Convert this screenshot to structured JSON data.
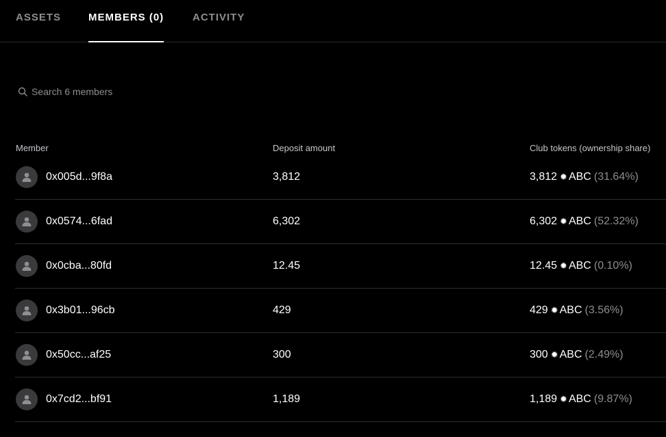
{
  "tabs": [
    {
      "label": "ASSETS",
      "active": false
    },
    {
      "label": "MEMBERS (0)",
      "active": true
    },
    {
      "label": "ACTIVITY",
      "active": false
    }
  ],
  "search": {
    "placeholder": "Search 6 members",
    "icon": "search-icon"
  },
  "table": {
    "headers": {
      "member": "Member",
      "deposit": "Deposit amount",
      "tokens": "Club tokens (ownership share)"
    },
    "token_symbol": "ABC",
    "token_icon": "sun-icon",
    "rows": [
      {
        "address": "0x005d...9f8a",
        "deposit": "3,812",
        "tokens": "3,812",
        "symbol": "ABC",
        "share": "(31.64%)"
      },
      {
        "address": "0x0574...6fad",
        "deposit": "6,302",
        "tokens": "6,302",
        "symbol": "ABC",
        "share": "(52.32%)"
      },
      {
        "address": "0x0cba...80fd",
        "deposit": "12.45",
        "tokens": "12.45",
        "symbol": "ABC",
        "share": "(0.10%)"
      },
      {
        "address": "0x3b01...96cb",
        "deposit": "429",
        "tokens": "429",
        "symbol": "ABC",
        "share": "(3.56%)"
      },
      {
        "address": "0x50cc...af25",
        "deposit": "300",
        "tokens": "300",
        "symbol": "ABC",
        "share": "(2.49%)"
      },
      {
        "address": "0x7cd2...bf91",
        "deposit": "1,189",
        "tokens": "1,189",
        "symbol": "ABC",
        "share": "(9.87%)"
      }
    ]
  },
  "colors": {
    "background": "#000000",
    "text": "#ffffff",
    "muted": "#8e8e93",
    "divider": "#2f2f31",
    "avatar_bg": "#3a3a3c"
  }
}
